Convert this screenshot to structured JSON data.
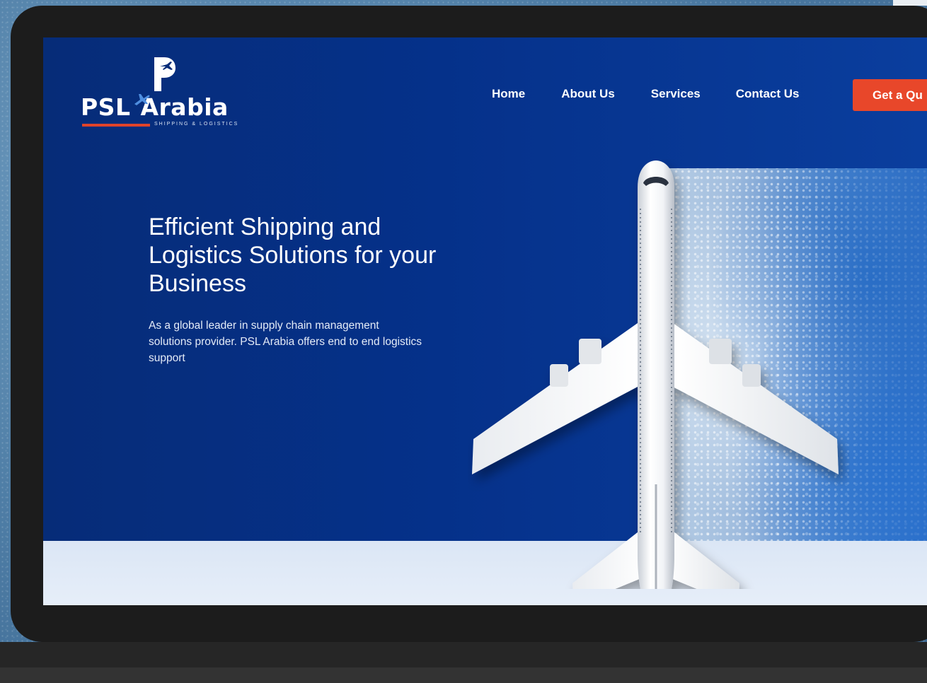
{
  "brand": {
    "name_part1": "PSL",
    "name_part2": "Arabia",
    "tagline": "SHIPPING & LOGISTICS"
  },
  "nav": {
    "items": [
      {
        "label": "Home"
      },
      {
        "label": "About Us"
      },
      {
        "label": "Services"
      },
      {
        "label": "Contact Us"
      }
    ],
    "cta_label": "Get a Qu"
  },
  "hero": {
    "headline": "Efficient Shipping and Logistics Solutions for your Business",
    "subtext": "As a global leader in supply chain management solutions provider. PSL Arabia offers end to end logistics support"
  },
  "colors": {
    "hero_bg": "#05318a",
    "cta_bg": "#e8472a",
    "frame": "#1c1c1c"
  }
}
